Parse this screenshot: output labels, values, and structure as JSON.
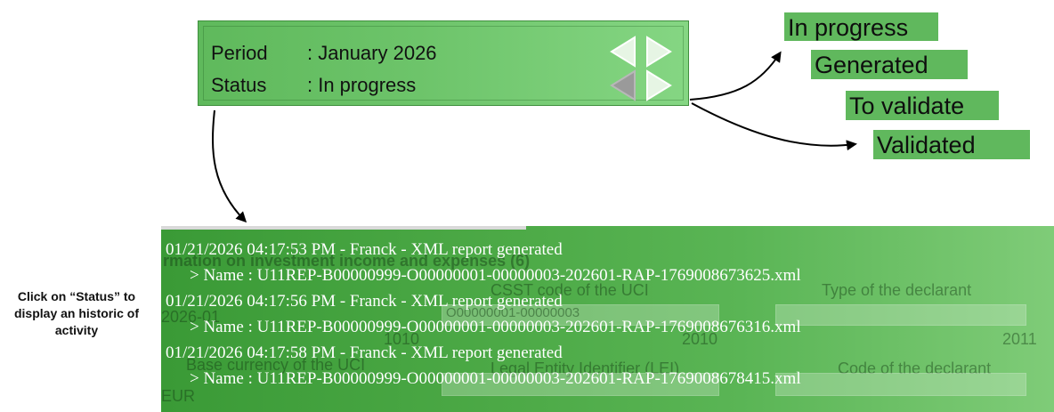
{
  "panel": {
    "period_label": "Period",
    "period_value": ": January 2026",
    "status_label": "Status",
    "status_value": ": In progress"
  },
  "status_options": [
    "In progress",
    "Generated",
    "To validate",
    "Validated"
  ],
  "caption": "Click on “Status” to display an historic of activity",
  "history": {
    "entries": [
      {
        "header": "01/21/2026 04:17:53 PM - Franck - XML report generated",
        "name": "> Name : U11REP-B00000999-O00000001-00000003-202601-RAP-1769008673625.xml"
      },
      {
        "header": "01/21/2026 04:17:56 PM - Franck - XML report generated",
        "name": "> Name : U11REP-B00000999-O00000001-00000003-202601-RAP-1769008676316.xml"
      },
      {
        "header": "01/21/2026 04:17:58 PM - Franck - XML report generated",
        "name": "> Name : U11REP-B00000999-O00000001-00000003-202601-RAP-1769008678415.xml"
      }
    ],
    "background": {
      "section_title": "rmation on investment income and expenses (6)",
      "date_value": "2026-01",
      "field_csst": "CSST code of the UCI",
      "field_csst_value": "O00000001-00000003",
      "field_declarant_type": "Type of the declarant",
      "code_1010": "1010",
      "code_2010": "2010",
      "code_2011": "2011",
      "field_currency": "Base currency of the UCI",
      "field_lei": "Legal Entity Identifier (LEI)",
      "field_declarant_code": "Code of the declarant",
      "currency_value": "EUR"
    }
  }
}
